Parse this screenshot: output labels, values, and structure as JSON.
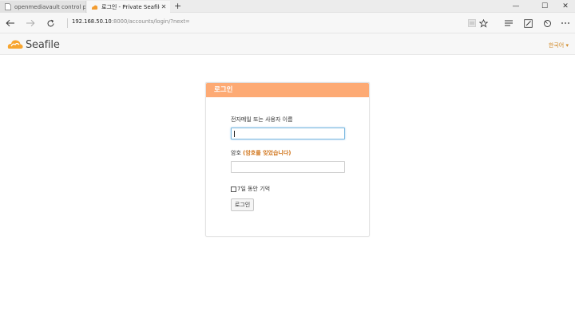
{
  "browser": {
    "tabs": [
      {
        "title": "openmediavault control par",
        "active": false
      },
      {
        "title": "로그인 - Private Seafile",
        "active": true
      }
    ],
    "new_tab": "+",
    "url_host": "192.168.50.10",
    "url_rest": ":8000/accounts/login/?next=",
    "window_controls": {
      "minimize": "—",
      "maximize": "☐",
      "close": "✕"
    },
    "toolbar_icons": [
      "reading-view-icon",
      "favorite-star-icon",
      "hub-icon",
      "web-note-icon",
      "share-icon",
      "more-icon"
    ]
  },
  "site": {
    "logo_text": "Seafile",
    "language": "한국어",
    "language_arrow": "▾",
    "brand_color": "#fdaa74"
  },
  "login": {
    "heading": "로그인",
    "username_label": "전자메일 또는 사용자 이름",
    "password_label": "암호",
    "forgot_label": "(암호를 잊었습니다)",
    "remember_label": "7일 동안 기억",
    "submit_label": "로그인"
  }
}
